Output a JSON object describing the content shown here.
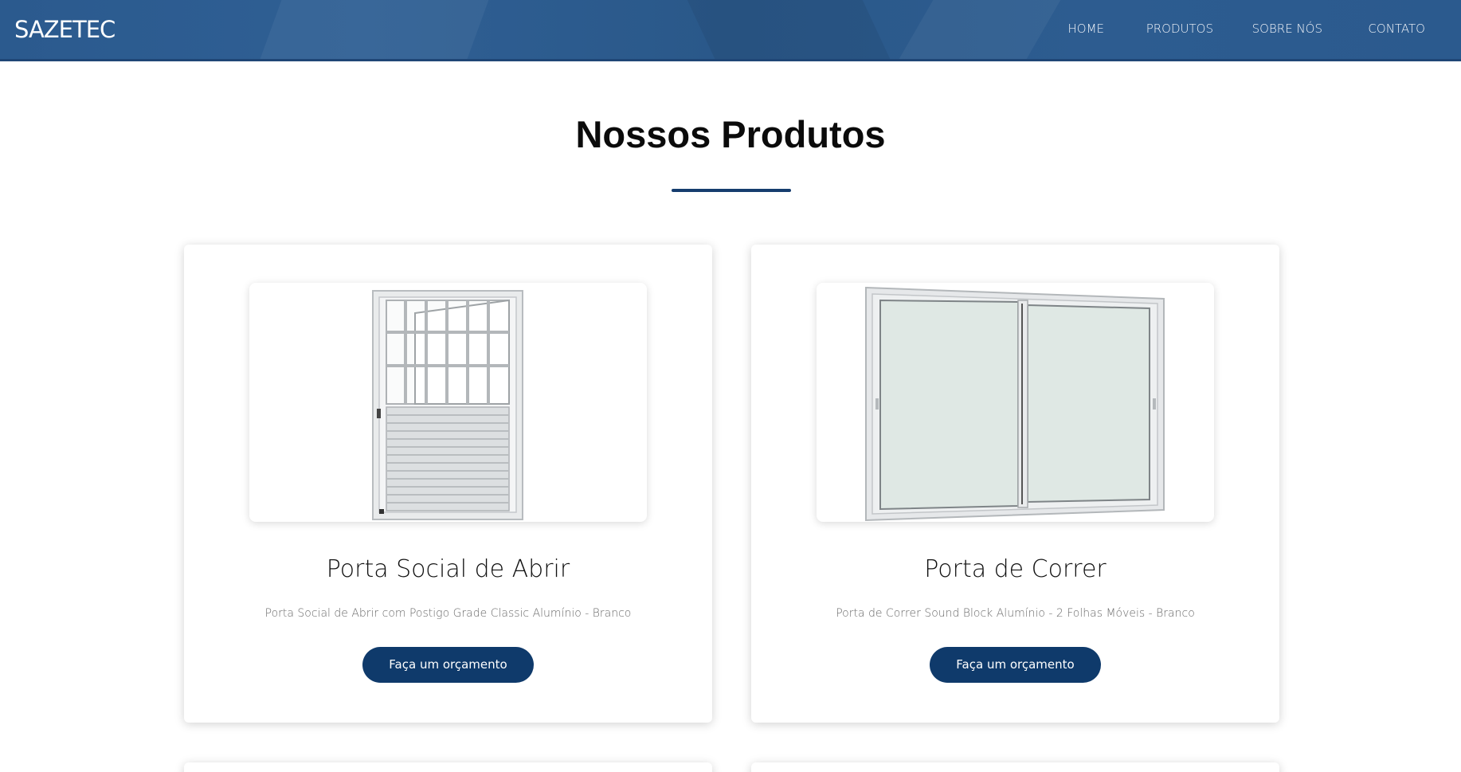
{
  "header": {
    "logo": "SAZETEC",
    "nav": [
      {
        "label": "HOME"
      },
      {
        "label": "PRODUTOS"
      },
      {
        "label": "SOBRE NÓS"
      },
      {
        "label": "CONTATO"
      }
    ]
  },
  "products_section": {
    "title": "Nossos Produtos",
    "accent_color": "#163d6e"
  },
  "products": [
    {
      "title": "Porta Social de Abrir",
      "description": "Porta Social de Abrir com Postigo Grade Classic Alumínio - Branco",
      "button_label": "Faça um orçamento",
      "image_icon": "door-with-grille-image"
    },
    {
      "title": "Porta de Correr",
      "description": "Porta de Correr Sound Block Alumínio - 2 Folhas Móveis - Branco",
      "button_label": "Faça um orçamento",
      "image_icon": "sliding-door-image"
    }
  ],
  "colors": {
    "header_bg": "#2b5a8e",
    "button_bg": "#0f3a6b",
    "text_dark": "#111111",
    "text_muted": "#6a6a6a"
  }
}
